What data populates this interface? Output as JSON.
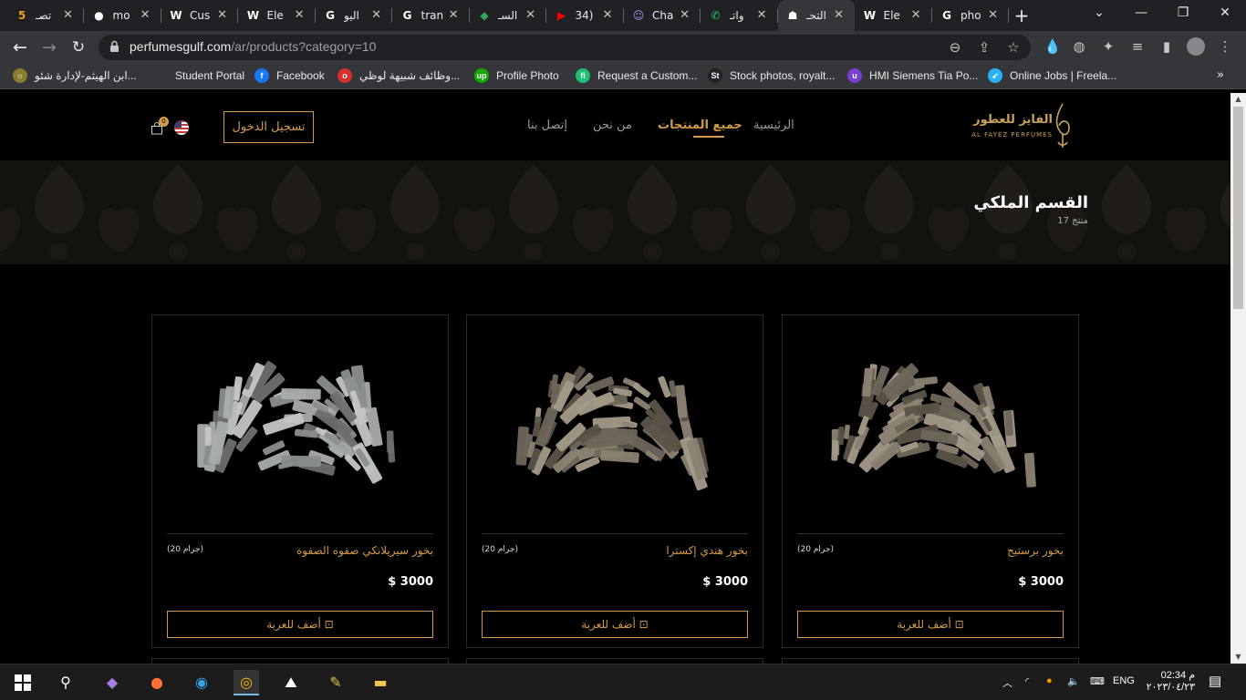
{
  "browser": {
    "tabs": [
      {
        "title": "تصـ",
        "icon": "number-icon",
        "color": "#e8a317",
        "glyph": "5"
      },
      {
        "title": "mo",
        "icon": "github-icon",
        "color": "#ffffff",
        "glyph": "●"
      },
      {
        "title": "Cus",
        "icon": "wordpress-icon",
        "color": "#ffffff",
        "glyph": "W"
      },
      {
        "title": "Ele",
        "icon": "wordpress-icon",
        "color": "#ffffff",
        "glyph": "W"
      },
      {
        "title": "اليو",
        "icon": "google-icon",
        "color": "#ffffff",
        "glyph": "G"
      },
      {
        "title": "tran",
        "icon": "google-icon",
        "color": "#ffffff",
        "glyph": "G"
      },
      {
        "title": "السـ",
        "icon": "maps-icon",
        "color": "#34a853",
        "glyph": "◆"
      },
      {
        "title": "(34",
        "icon": "youtube-icon",
        "color": "#ff0000",
        "glyph": "▶"
      },
      {
        "title": "Cha",
        "icon": "chat-icon",
        "color": "#a98bf5",
        "glyph": "☺"
      },
      {
        "title": "واتـ",
        "icon": "whatsapp-icon",
        "color": "#25d366",
        "glyph": "✆"
      },
      {
        "title": "التحـ",
        "icon": "site-icon",
        "color": "#ffffff",
        "glyph": "☗",
        "active": true
      },
      {
        "title": "Ele",
        "icon": "wordpress-icon",
        "color": "#ffffff",
        "glyph": "W"
      },
      {
        "title": "pho",
        "icon": "google-icon",
        "color": "#ffffff",
        "glyph": "G"
      }
    ],
    "url_host": "perfumesgulf.com",
    "url_path": "/ar/products?category=10",
    "bookmarks": [
      {
        "label": "ابن الهيثم-لإدارة شئو...",
        "icon": "globe-icon",
        "color": "#8a7d2f",
        "glyph": "☼"
      },
      {
        "label": "Student Portal",
        "icon": "folder-icon",
        "color": "transparent",
        "glyph": ""
      },
      {
        "label": "Facebook",
        "icon": "facebook-icon",
        "color": "#1877f2",
        "glyph": "f"
      },
      {
        "label": "وظائف شبيهة لوظي...",
        "icon": "job-icon",
        "color": "#d62f2f",
        "glyph": "o"
      },
      {
        "label": "Profile Photo",
        "icon": "upwork-icon",
        "color": "#14a800",
        "glyph": "up"
      },
      {
        "label": "Request a Custom...",
        "icon": "fiverr-icon",
        "color": "#1dbf73",
        "glyph": "fi"
      },
      {
        "label": "Stock photos, royalt...",
        "icon": "shutterstock-icon",
        "color": "#222222",
        "glyph": "St"
      },
      {
        "label": "HMI Siemens Tia Po...",
        "icon": "tia-icon",
        "color": "#7b3fd1",
        "glyph": "u"
      },
      {
        "label": "Online Jobs | Freela...",
        "icon": "freelancer-icon",
        "color": "#29b2fe",
        "glyph": "➶"
      }
    ]
  },
  "site": {
    "logo_ar": "الفايز للعطور",
    "logo_en": "AL FAYEZ PERFUMES",
    "nav": {
      "home": "الرئيسية",
      "all_products": "جميع المنتجات",
      "about": "من نحن",
      "contact": "إتصل بنا"
    },
    "login_label": "تسجيل الدخول",
    "cart_count": "0",
    "accent": "#d49a4a"
  },
  "category": {
    "title": "القسم الملكي",
    "count": "17 منتج"
  },
  "products": [
    {
      "name": "بخور برستيج",
      "weight": "(جرام 20)",
      "price": "$ 3000",
      "button": "أضف للعربة"
    },
    {
      "name": "بخور هندي إكسترا",
      "weight": "(جرام 20)",
      "price": "$ 3000",
      "button": "أضف للعربة"
    },
    {
      "name": "بخور سيريلانكي صفوه الصفوة",
      "weight": "(جرام 20)",
      "price": "$ 3000",
      "button": "أضف للعربة"
    }
  ],
  "taskbar": {
    "lang": "ENG",
    "time": "02:34 م",
    "date": "٢٠٢٣/٠٤/٢٣",
    "notifications": "1"
  }
}
